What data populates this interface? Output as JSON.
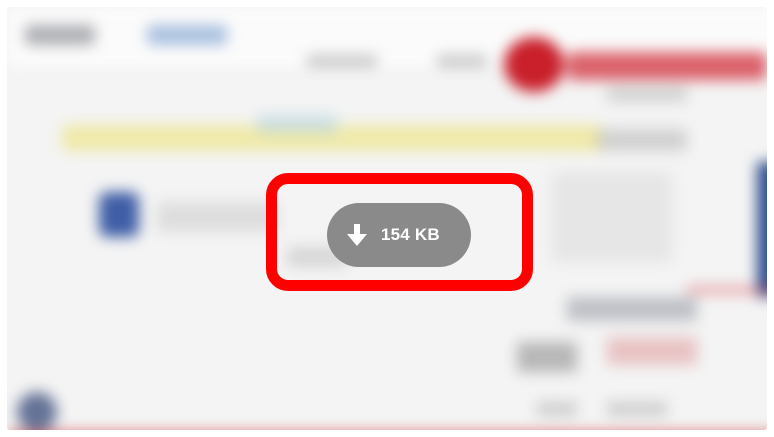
{
  "download_chip": {
    "size_label": "154 KB",
    "icon": "arrow-down-icon"
  },
  "colors": {
    "highlight": "#ff0000",
    "chip_background": "#8a8a8a",
    "chip_text": "#ffffff"
  }
}
